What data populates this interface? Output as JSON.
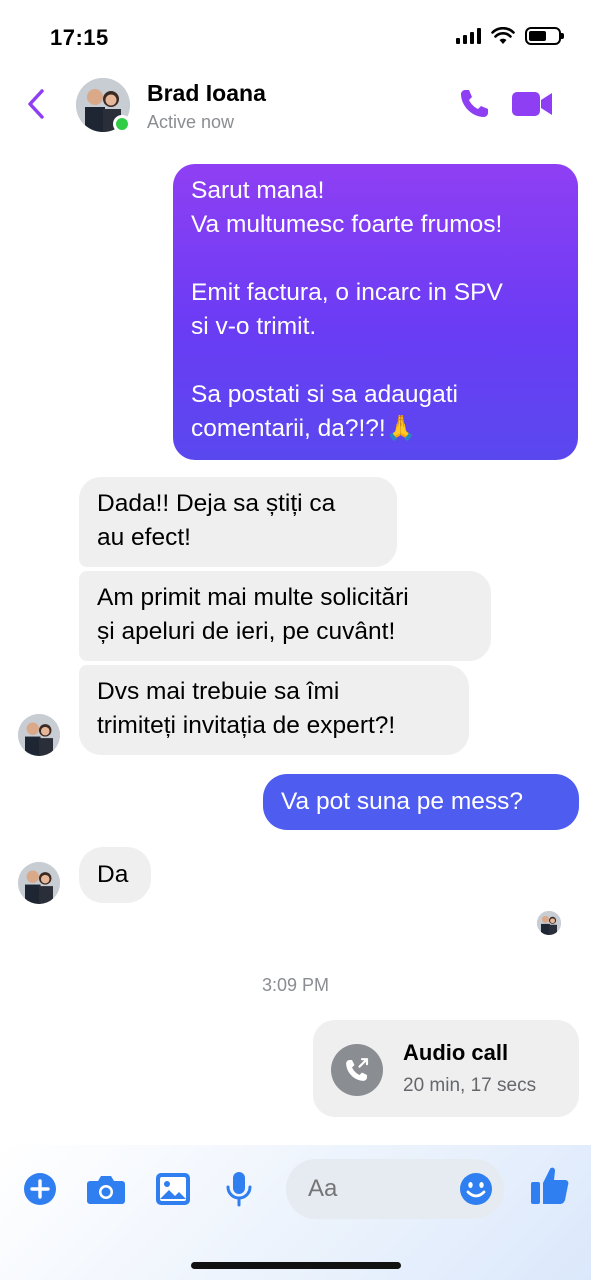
{
  "status_bar": {
    "time": "17:15"
  },
  "header": {
    "contact_name": "Brad Ioana",
    "contact_status": "Active now"
  },
  "messages": [
    {
      "from": "me",
      "lines": [
        "Sarut mana!",
        "Va multumesc foarte frumos!",
        "",
        "Emit factura, o incarc in SPV",
        "si v-o trimit.",
        "",
        "Sa postati si sa adaugati",
        "comentarii, da?!?!🙏"
      ]
    },
    {
      "from": "them",
      "lines": [
        "Dada!! Deja sa știți ca",
        "au efect!"
      ]
    },
    {
      "from": "them",
      "lines": [
        "Am primit mai multe solicitări",
        "și apeluri de ieri, pe cuvânt!"
      ]
    },
    {
      "from": "them",
      "lines": [
        "Dvs mai trebuie sa îmi",
        "trimiteți invitația de expert?!"
      ]
    },
    {
      "from": "me",
      "lines": [
        "Va pot suna pe mess?"
      ]
    },
    {
      "from": "them",
      "lines": [
        "Da"
      ]
    }
  ],
  "timestamp": "3:09 PM",
  "call_card": {
    "title": "Audio call",
    "duration": "20 min, 17 secs"
  },
  "composer": {
    "placeholder": "Aa"
  },
  "colors": {
    "accent": "#8f3ff3",
    "outgoing_blue": "#4f5cf0",
    "incoming_bg": "#efeff0",
    "active_green": "#31cc46"
  },
  "icons": [
    "back-chevron-icon",
    "phone-icon",
    "video-camera-icon",
    "plus-icon",
    "camera-icon",
    "gallery-icon",
    "microphone-icon",
    "emoji-icon",
    "thumbs-up-icon",
    "audio-call-icon"
  ]
}
